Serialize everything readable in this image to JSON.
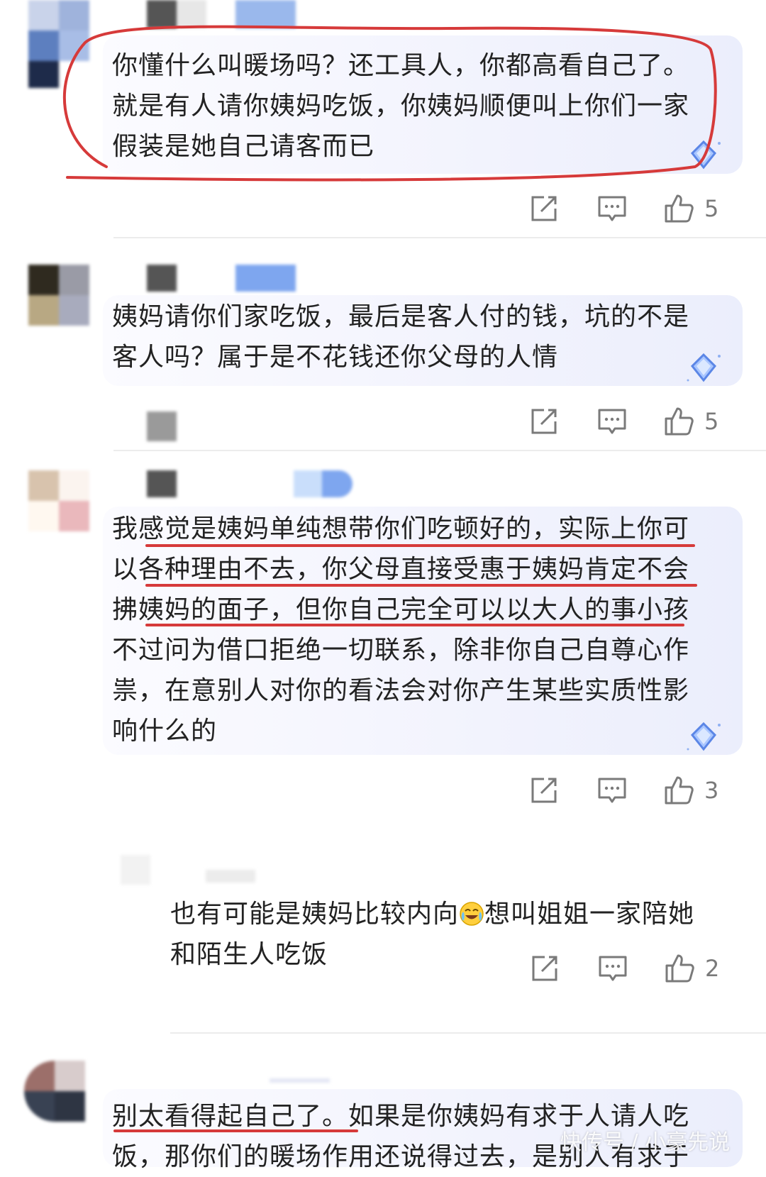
{
  "comments": [
    {
      "text": "你懂什么叫暖场吗？还工具人，你都高看自己了。\n就是有人请你姨妈吃饭，你姨妈顺便叫上你们一家\n假装是她自己请客而已",
      "likes": "5"
    },
    {
      "text": "姨妈请你们家吃饭，最后是客人付的钱，坑的不是\n客人吗？属于是不花钱还你父母的人情",
      "likes": "5"
    },
    {
      "text": "我感觉是姨妈单纯想带你们吃顿好的，实际上你可\n以各种理由不去，你父母直接受惠于姨妈肯定不会\n拂姨妈的面子，但你自己完全可以以大人的事小孩\n不过问为借口拒绝一切联系，除非你自己自尊心作\n祟，在意别人对你的看法会对你产生某些实质性影\n响什么的",
      "likes": "3"
    },
    {
      "text_before_emoji": "也有可能是姨妈比较内向",
      "text_after_emoji": "想叫姐姐一家陪她\n和陌生人吃饭",
      "emoji": "crying-laugh-emoji",
      "likes": "2"
    },
    {
      "text": "别太看得起自己了。如果是你姨妈有求于人请人吃\n饭，那你们的暖场作用还说得过去，是别人有求于"
    }
  ],
  "watermark": "快传号 / 小豪先说",
  "icons": {
    "share": "share-icon",
    "comment": "comment-icon",
    "like": "thumbs-up-icon",
    "badge": "diamond-badge-icon"
  },
  "colors": {
    "annotation_red": "#d63a3a",
    "bubble_tint": "#eef0fc",
    "icon_gray": "#7a7a7a"
  }
}
